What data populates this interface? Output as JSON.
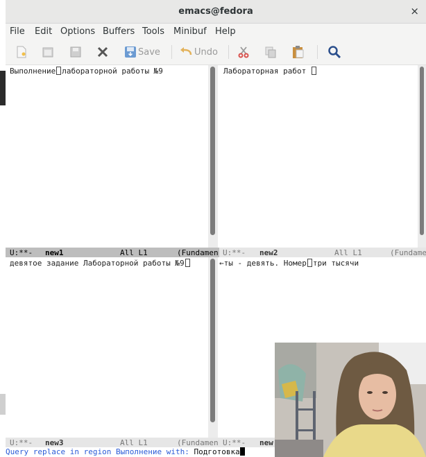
{
  "window": {
    "title": "emacs@fedora",
    "close_glyph": "×"
  },
  "menu": [
    "File",
    "Edit",
    "Options",
    "Buffers",
    "Tools",
    "Minibuf",
    "Help"
  ],
  "toolbar": {
    "save_label": "Save",
    "undo_label": "Undo",
    "icons": [
      "new-file-icon",
      "open-folder-icon",
      "disk-icon",
      "close-x-icon",
      "save-icon",
      "undo-icon",
      "cut-icon",
      "copy-icon",
      "paste-icon",
      "search-icon"
    ]
  },
  "windows": {
    "top_left": {
      "text_before": "Выполнение",
      "text_after": "лабораторной работы №9"
    },
    "top_right": {
      "text": "Лабораторная работ "
    },
    "bottom_left": {
      "text": "девятое задание Лабораторной работы №9"
    },
    "bottom_right": {
      "text_before": "ты - девять. Номер",
      "text_after": "три тысячи",
      "wrap_glyph": "←"
    }
  },
  "modelines": {
    "top_left": {
      "status": "U:**-",
      "buffer": "new1",
      "position": "All L1",
      "mode": "(Fundamen"
    },
    "top_right": {
      "status": "U:**-",
      "buffer": "new2",
      "position": "All L1",
      "mode": "(Fundame"
    },
    "bottom_left": {
      "status": "U:**-",
      "buffer": "new3",
      "position": "All L1",
      "mode": "(Fundamen"
    },
    "bottom_right": {
      "status": "U:**-",
      "buffer": "new"
    }
  },
  "minibuffer": {
    "prompt": "Query replace in region Выполнение with: ",
    "input": "Подготовка"
  }
}
